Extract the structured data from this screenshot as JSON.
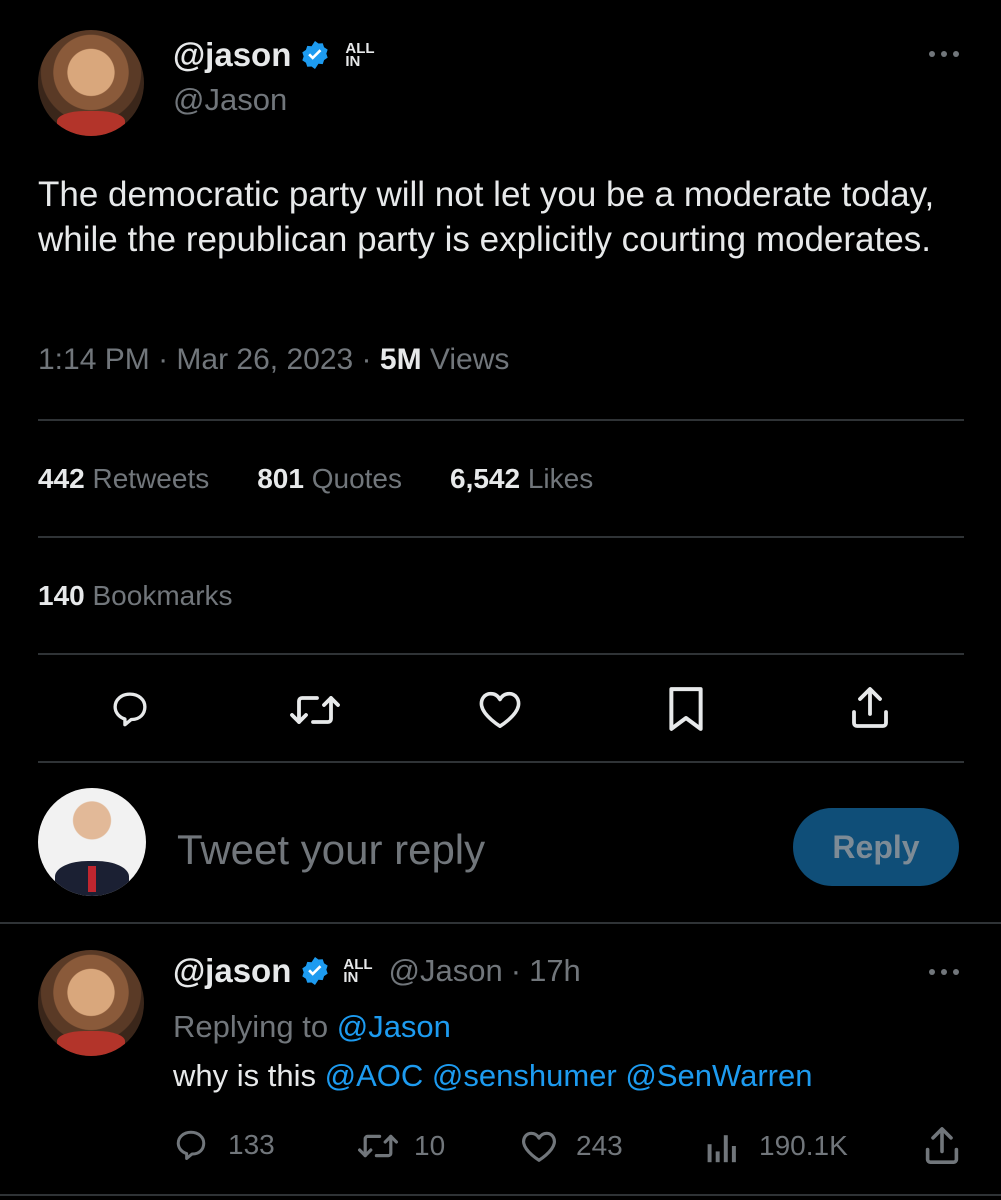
{
  "tweet": {
    "display_name": "@jason",
    "handle": "@Jason",
    "badge": "ALL\nIN",
    "badge_line1": "ALL",
    "badge_line2": "IN",
    "text": "The democratic party will not let you be a moderate today, while the republican party is explicitly courting moderates.",
    "time": "1:14 PM",
    "date": "Mar 26, 2023",
    "views_count": "5M",
    "views_label": "Views",
    "separator": "·",
    "more_icon": "more-dots-icon",
    "stats": {
      "retweets_count": "442",
      "retweets_label": "Retweets",
      "quotes_count": "801",
      "quotes_label": "Quotes",
      "likes_count": "6,542",
      "likes_label": "Likes",
      "bookmarks_count": "140",
      "bookmarks_label": "Bookmarks"
    },
    "actions": [
      "reply-icon",
      "retweet-icon",
      "like-icon",
      "bookmark-icon",
      "share-icon"
    ]
  },
  "composer": {
    "placeholder": "Tweet your reply",
    "button_label": "Reply"
  },
  "reply": {
    "display_name": "@jason",
    "badge_line1": "ALL",
    "badge_line2": "IN",
    "handle": "@Jason",
    "separator": "·",
    "age": "17h",
    "replying_prefix": "Replying to",
    "replying_to": "@Jason",
    "text_prefix": "why is this",
    "mentions": [
      "@AOC",
      "@senshumer",
      "@SenWarren"
    ],
    "counts": {
      "replies": "133",
      "retweets": "10",
      "likes": "243",
      "views": "190.1K"
    }
  },
  "colors": {
    "background": "#000000",
    "text": "#e7e9ea",
    "muted": "#71767b",
    "accent": "#1d9bf0",
    "divider": "#2f3336",
    "reply_button_bg": "#0f4e78"
  }
}
